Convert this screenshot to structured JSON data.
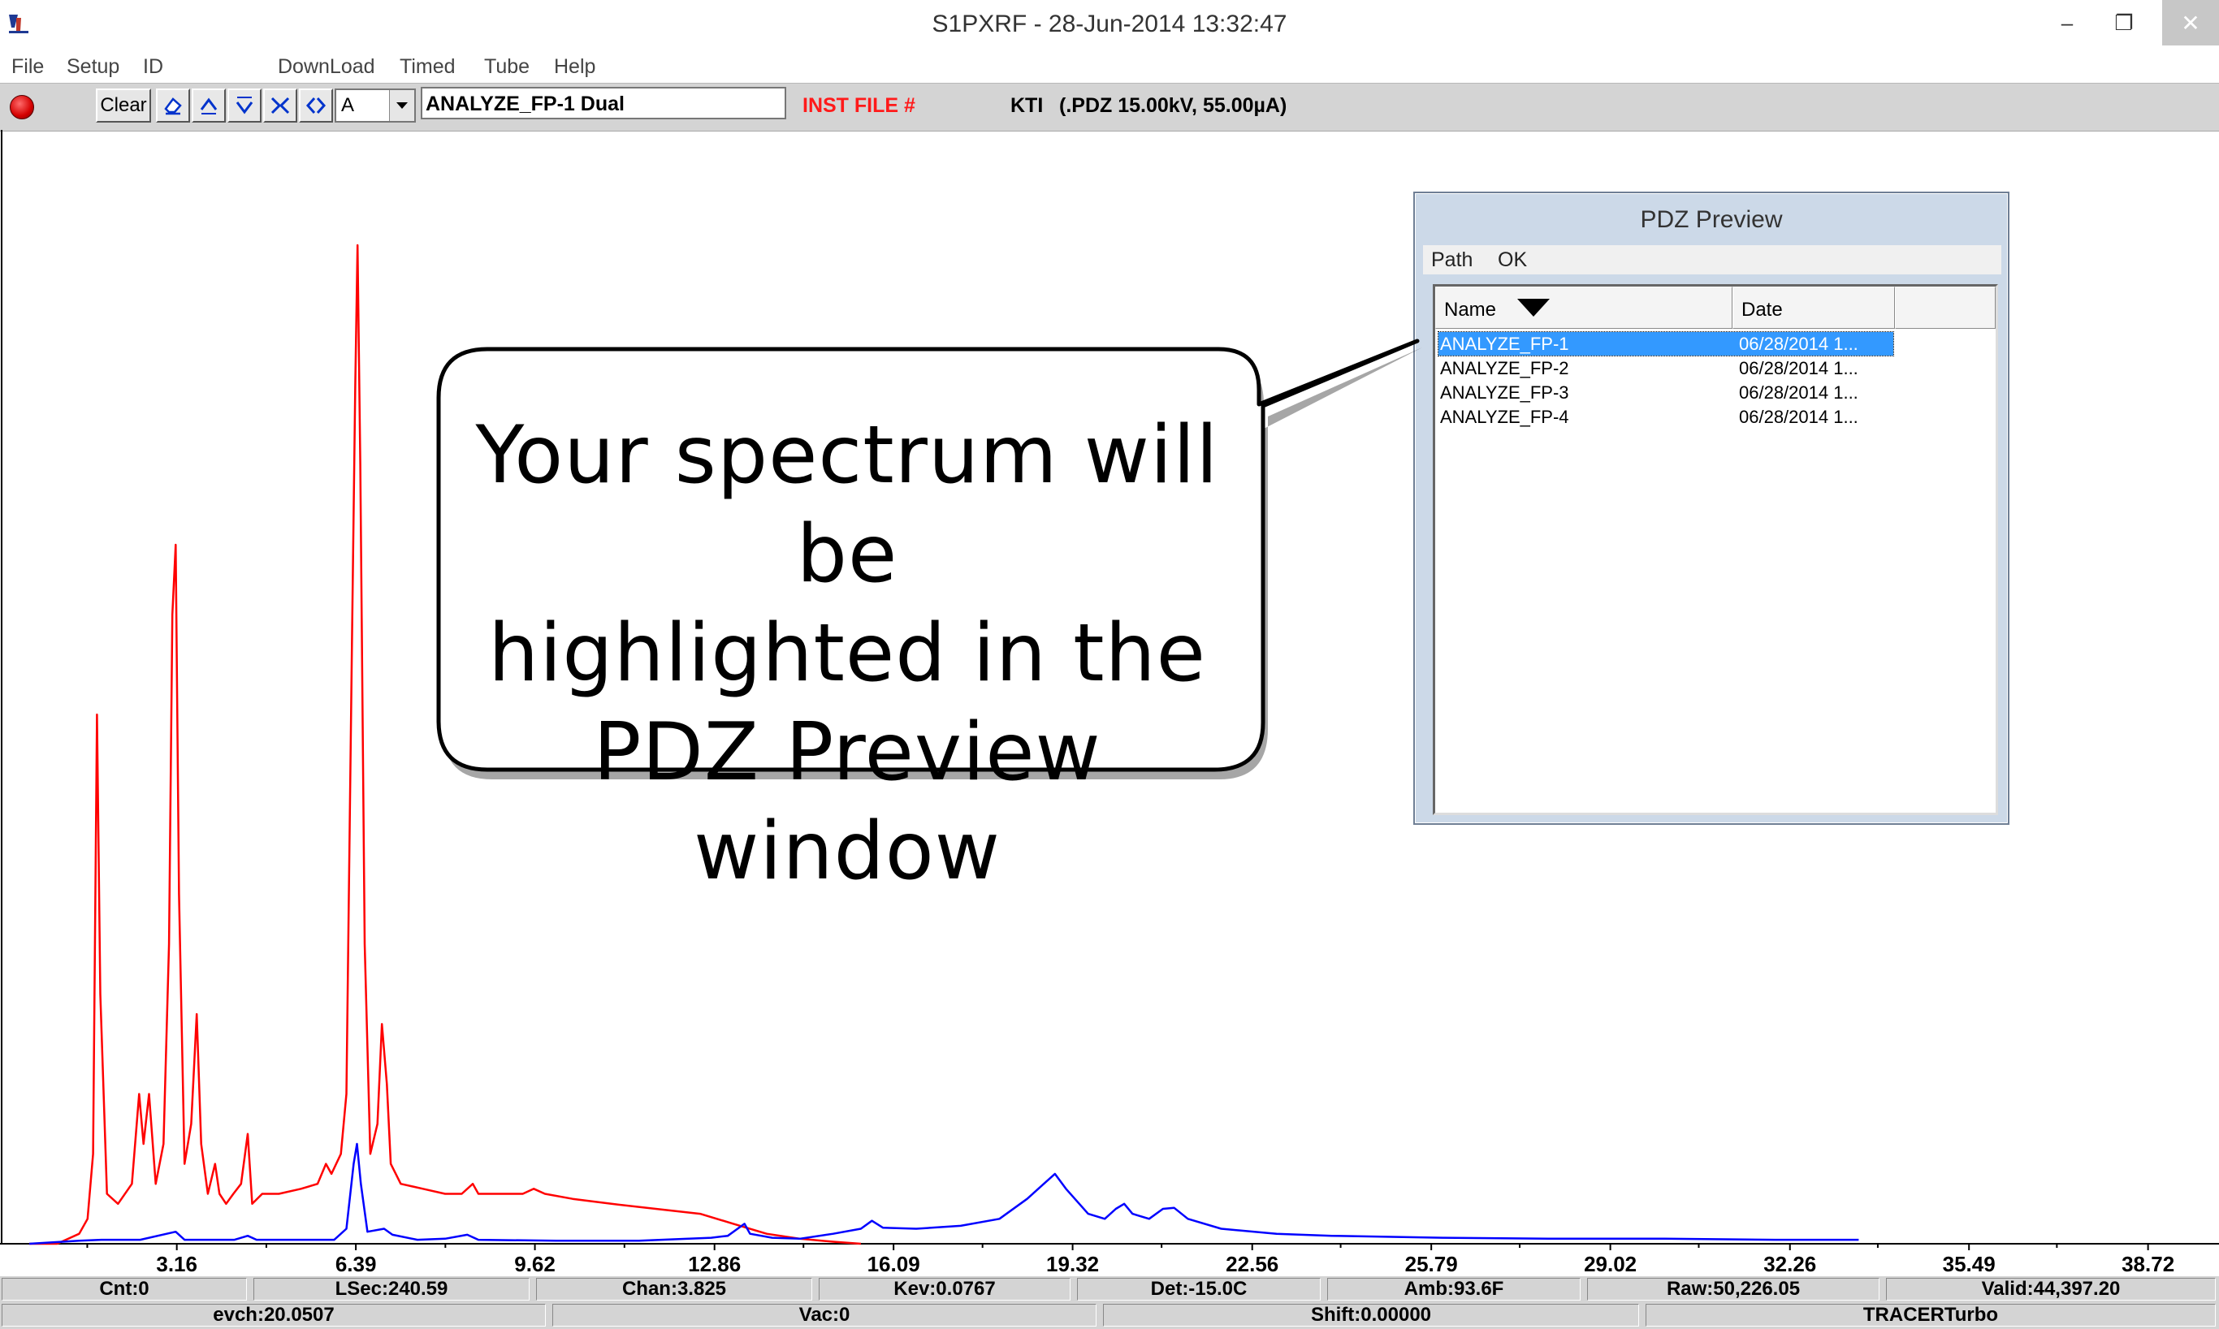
{
  "window": {
    "title": "S1PXRF - 28-Jun-2014 13:32:47",
    "minimize_glyph": "–",
    "maximize_glyph": "❐",
    "close_glyph": "✕"
  },
  "menu": [
    "File",
    "Setup",
    "ID",
    "DownLoad",
    "Timed",
    "Tube",
    "Help"
  ],
  "toolbar": {
    "clear_label": "Clear",
    "channel_value": "A",
    "file_name": "ANALYZE_FP-1 Dual",
    "inst_file_label": "INST FILE #",
    "kti_label": "KTI",
    "kti_value": "(.PDZ 15.00kV, 55.00µA)",
    "buttons": [
      "eraser-icon",
      "arrow-up-icon",
      "arrow-down-icon",
      "collapse-icon",
      "expand-icon"
    ]
  },
  "chart_data": {
    "type": "line",
    "x_ticks": [
      "3.16",
      "6.39",
      "9.62",
      "12.86",
      "16.09",
      "19.32",
      "22.56",
      "25.79",
      "29.02",
      "32.26",
      "35.49",
      "38.72"
    ],
    "xlim": [
      0,
      40
    ],
    "ylim": [
      0,
      100
    ],
    "grid": false,
    "series": [
      {
        "color": "#ff0000",
        "points": [
          [
            0.5,
            0
          ],
          [
            1.0,
            0
          ],
          [
            1.4,
            1
          ],
          [
            1.55,
            2.5
          ],
          [
            1.65,
            9
          ],
          [
            1.72,
            53
          ],
          [
            1.78,
            25
          ],
          [
            1.9,
            5
          ],
          [
            2.1,
            4
          ],
          [
            2.35,
            6
          ],
          [
            2.48,
            15
          ],
          [
            2.56,
            10
          ],
          [
            2.66,
            15
          ],
          [
            2.78,
            6
          ],
          [
            2.92,
            10
          ],
          [
            3.02,
            30
          ],
          [
            3.08,
            63
          ],
          [
            3.14,
            70
          ],
          [
            3.2,
            35
          ],
          [
            3.3,
            8
          ],
          [
            3.42,
            12
          ],
          [
            3.52,
            23
          ],
          [
            3.6,
            10
          ],
          [
            3.72,
            5
          ],
          [
            3.85,
            8
          ],
          [
            3.93,
            5
          ],
          [
            4.05,
            4
          ],
          [
            4.18,
            5
          ],
          [
            4.32,
            6
          ],
          [
            4.44,
            11
          ],
          [
            4.52,
            4
          ],
          [
            4.7,
            5
          ],
          [
            5.0,
            5
          ],
          [
            5.4,
            5.5
          ],
          [
            5.7,
            6
          ],
          [
            5.85,
            8
          ],
          [
            5.95,
            7
          ],
          [
            6.12,
            9
          ],
          [
            6.22,
            15
          ],
          [
            6.32,
            60
          ],
          [
            6.38,
            86
          ],
          [
            6.42,
            100
          ],
          [
            6.47,
            78
          ],
          [
            6.55,
            30
          ],
          [
            6.65,
            9
          ],
          [
            6.78,
            12
          ],
          [
            6.86,
            22
          ],
          [
            6.95,
            16
          ],
          [
            7.02,
            8
          ],
          [
            7.2,
            6
          ],
          [
            7.6,
            5.5
          ],
          [
            8.0,
            5
          ],
          [
            8.3,
            5
          ],
          [
            8.5,
            6
          ],
          [
            8.6,
            5
          ],
          [
            9.0,
            5
          ],
          [
            9.4,
            5
          ],
          [
            9.6,
            5.5
          ],
          [
            9.8,
            5
          ],
          [
            10.3,
            4.5
          ],
          [
            11.0,
            4
          ],
          [
            11.8,
            3.5
          ],
          [
            12.6,
            3
          ],
          [
            13.2,
            2
          ],
          [
            13.8,
            1
          ],
          [
            14.4,
            0.5
          ],
          [
            15.0,
            0.2
          ],
          [
            15.5,
            0
          ]
        ]
      },
      {
        "color": "#0000ff",
        "points": [
          [
            0.5,
            0
          ],
          [
            1.4,
            0.3
          ],
          [
            1.8,
            0.4
          ],
          [
            2.5,
            0.4
          ],
          [
            3.14,
            1.2
          ],
          [
            3.3,
            0.4
          ],
          [
            4.2,
            0.4
          ],
          [
            4.44,
            0.8
          ],
          [
            4.6,
            0.4
          ],
          [
            6.0,
            0.4
          ],
          [
            6.22,
            1.5
          ],
          [
            6.35,
            8
          ],
          [
            6.41,
            10
          ],
          [
            6.48,
            6
          ],
          [
            6.6,
            1.2
          ],
          [
            6.9,
            1.5
          ],
          [
            7.05,
            0.9
          ],
          [
            7.5,
            0.4
          ],
          [
            8.0,
            0.5
          ],
          [
            8.4,
            0.9
          ],
          [
            8.6,
            0.4
          ],
          [
            10.0,
            0.3
          ],
          [
            11.5,
            0.3
          ],
          [
            12.8,
            0.6
          ],
          [
            13.1,
            0.8
          ],
          [
            13.4,
            2
          ],
          [
            13.5,
            1
          ],
          [
            13.9,
            0.6
          ],
          [
            14.4,
            0.5
          ],
          [
            15.0,
            1.0
          ],
          [
            15.5,
            1.5
          ],
          [
            15.7,
            2.3
          ],
          [
            15.9,
            1.6
          ],
          [
            16.5,
            1.5
          ],
          [
            17.3,
            1.8
          ],
          [
            18.0,
            2.5
          ],
          [
            18.5,
            4.5
          ],
          [
            18.8,
            6
          ],
          [
            19.0,
            7
          ],
          [
            19.2,
            5.5
          ],
          [
            19.6,
            3
          ],
          [
            19.9,
            2.5
          ],
          [
            20.1,
            3.5
          ],
          [
            20.25,
            4
          ],
          [
            20.4,
            3
          ],
          [
            20.7,
            2.5
          ],
          [
            20.95,
            3.5
          ],
          [
            21.15,
            3.6
          ],
          [
            21.4,
            2.5
          ],
          [
            22.0,
            1.5
          ],
          [
            23.0,
            1.0
          ],
          [
            24.0,
            0.8
          ],
          [
            26.0,
            0.6
          ],
          [
            28.0,
            0.5
          ],
          [
            30.0,
            0.5
          ],
          [
            32.0,
            0.4
          ],
          [
            33.5,
            0.4
          ]
        ]
      }
    ]
  },
  "status": {
    "cnt": "Cnt:0",
    "lsec": "LSec:240.59",
    "chan": "Chan:3.825",
    "kev": "Kev:0.0767",
    "det": "Det:-15.0C",
    "amb": "Amb:93.6F",
    "raw": "Raw:50,226.05",
    "valid": "Valid:44,397.20",
    "evch": "evch:20.0507",
    "vac": "Vac:0",
    "shift": "Shift:0.00000",
    "model": "TRACERTurbo"
  },
  "pdz_preview": {
    "title": "PDZ Preview",
    "menu": [
      "Path",
      "OK"
    ],
    "col_name": "Name",
    "col_date": "Date",
    "rows": [
      {
        "name": "ANALYZE_FP-1",
        "date": "06/28/2014 1...",
        "selected": true
      },
      {
        "name": "ANALYZE_FP-2",
        "date": "06/28/2014 1...",
        "selected": false
      },
      {
        "name": "ANALYZE_FP-3",
        "date": "06/28/2014 1...",
        "selected": false
      },
      {
        "name": "ANALYZE_FP-4",
        "date": "06/28/2014 1...",
        "selected": false
      }
    ]
  },
  "callout": {
    "line1": "Your spectrum will be",
    "line2": "highlighted in the",
    "line3": "PDZ Preview window"
  },
  "colors": {
    "toolbar_bg": "#d4d4d4",
    "inst_file": "#ff1a1a",
    "selection": "#3399ff",
    "dialog_frame": "#ccd9e8"
  }
}
